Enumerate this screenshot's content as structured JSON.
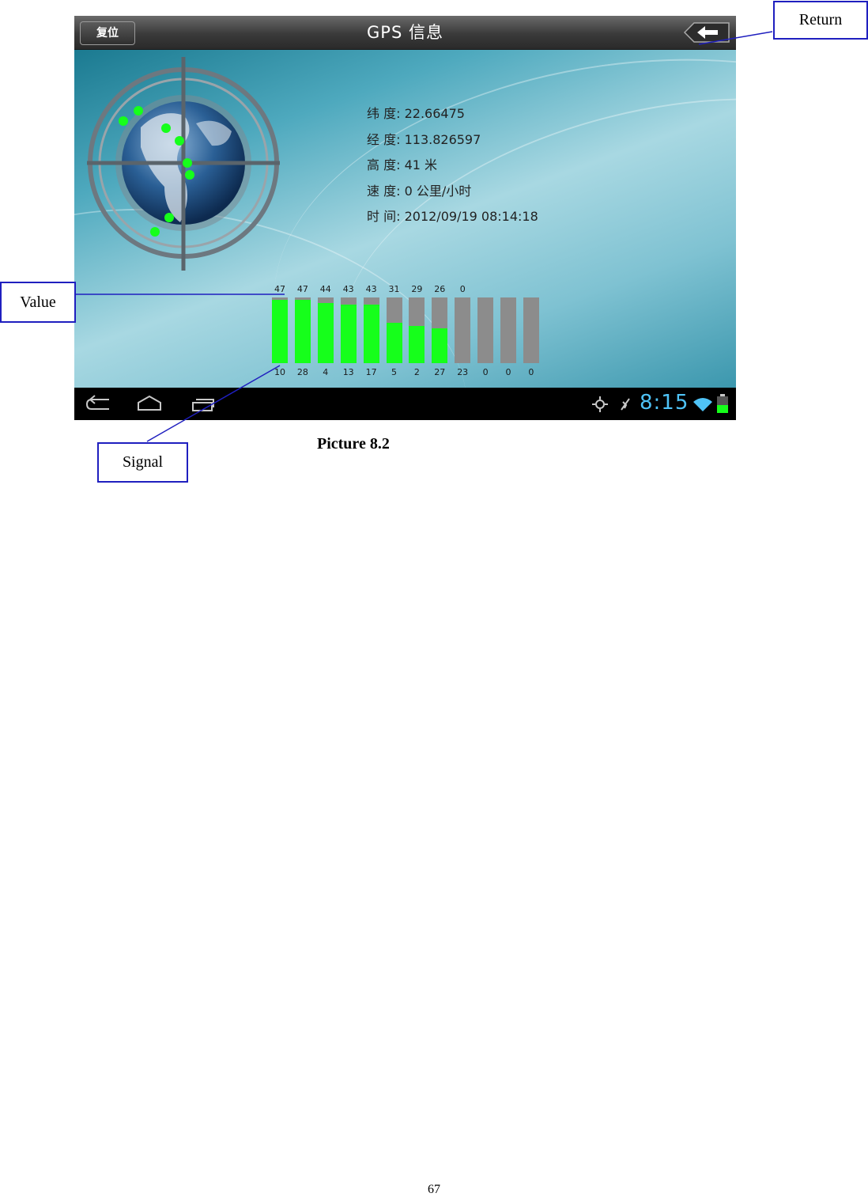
{
  "device": {
    "reset_button": "复位",
    "title": "GPS 信息",
    "info": [
      {
        "label": "纬 度:",
        "value": "22.66475"
      },
      {
        "label": "经 度:",
        "value": "113.826597"
      },
      {
        "label": "高 度:",
        "value": "41 米"
      },
      {
        "label": "速 度:",
        "value": "0 公里/小时"
      },
      {
        "label": "时 间:",
        "value": "2012/09/19  08:14:18"
      }
    ],
    "satellites": {
      "values": [
        "47",
        "47",
        "44",
        "43",
        "43",
        "31",
        "29",
        "26",
        "0",
        "",
        "",
        ""
      ],
      "signals": [
        "10",
        "28",
        "4",
        "13",
        "17",
        "5",
        "2",
        "27",
        "23",
        "0",
        "0",
        "0"
      ],
      "fill_fraction": [
        0.96,
        0.96,
        0.92,
        0.89,
        0.89,
        0.62,
        0.57,
        0.53,
        0,
        0,
        0,
        0
      ]
    },
    "clock": "8:15",
    "accent_color": "#16ff1b"
  },
  "callouts": {
    "return": "Return",
    "value": "Value",
    "signal": "Signal"
  },
  "caption": "Picture 8.2",
  "page_number": "67"
}
